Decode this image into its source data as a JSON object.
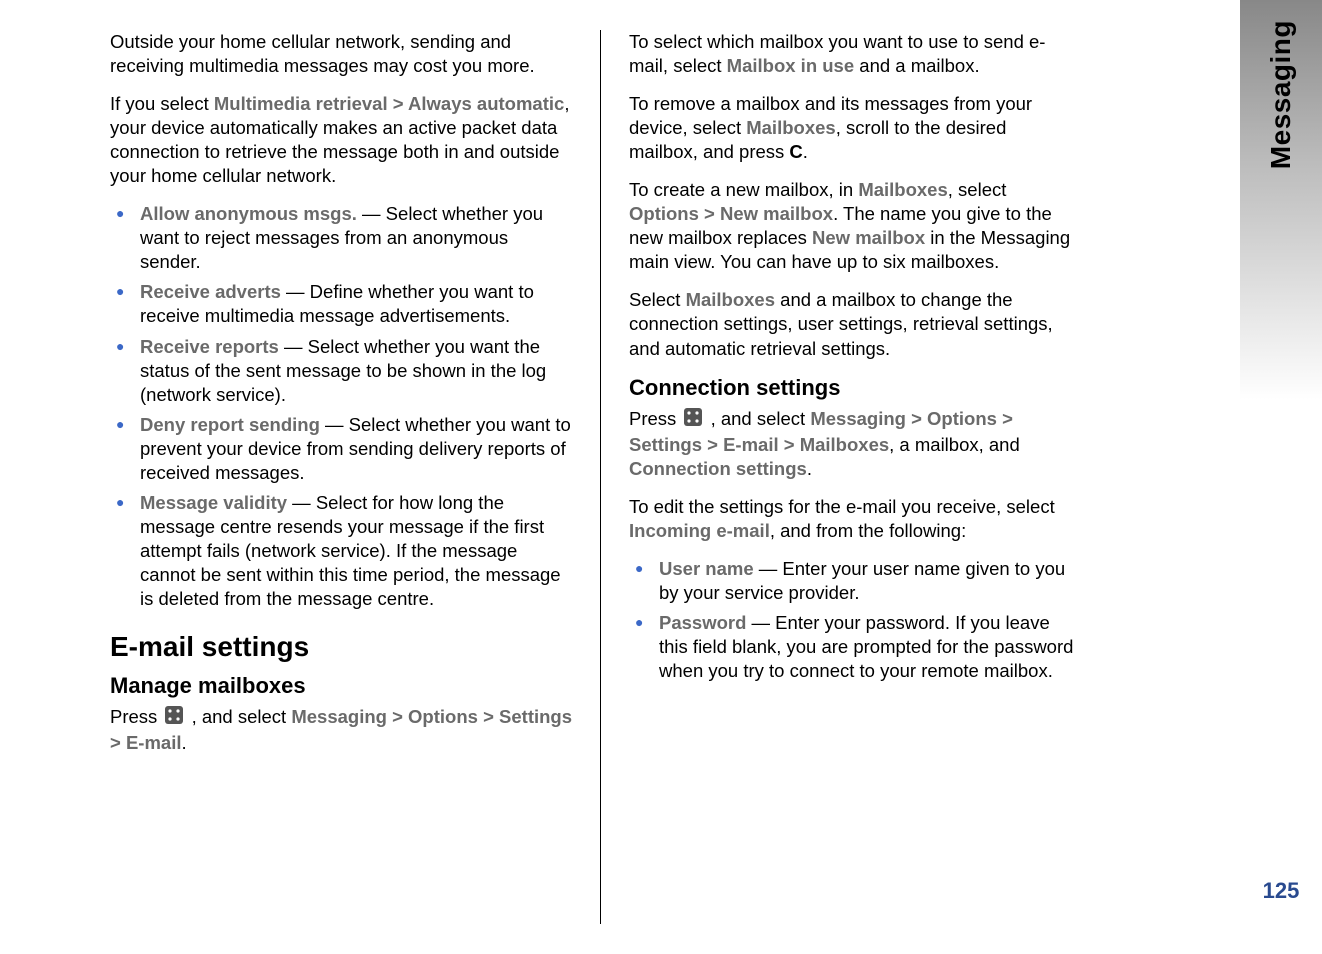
{
  "sidebar": {
    "section_title": "Messaging",
    "page_number": "125"
  },
  "left": {
    "p_cost": "Outside your home cellular network, sending and receiving multimedia messages may cost you more.",
    "retrieval": {
      "t1": "If you select ",
      "m1": "Multimedia retrieval",
      "gt1": " > ",
      "m2": "Always automatic",
      "t2": ", your device automatically makes an active packet data connection to retrieve the message both in and outside your home cellular network."
    },
    "bullets": [
      {
        "label": "Allow anonymous msgs.",
        "text": " — Select whether you want to reject messages from an anonymous sender."
      },
      {
        "label": "Receive adverts",
        "text": " — Define whether you want to receive multimedia message advertisements."
      },
      {
        "label": "Receive reports",
        "text": " — Select whether you want the status of the sent message to be shown in the log (network service)."
      },
      {
        "label": "Deny report sending",
        "text": " — Select whether you want to prevent your device from sending delivery reports of received messages."
      },
      {
        "label": "Message validity",
        "text": " — Select for how long the message centre resends your message if the first attempt fails (network service). If the message cannot be sent within this time period, the message is deleted from the message centre."
      }
    ],
    "h2_email": "E-mail settings",
    "h3_manage": "Manage mailboxes",
    "nav_manage": {
      "t1": "Press ",
      "t2": " , and select ",
      "m1": "Messaging",
      "gt1": " > ",
      "m2": "Options",
      "gt2": " > ",
      "m3": "Settings",
      "gt3": " > ",
      "m4": "E-mail",
      "t3": "."
    }
  },
  "right": {
    "p_select": {
      "t1": "To select which mailbox you want to use to send e-mail, select ",
      "m1": "Mailbox in use",
      "t2": " and a mailbox."
    },
    "p_remove": {
      "t1": "To remove a mailbox and its messages from your device, select ",
      "m1": "Mailboxes",
      "t2": ", scroll to the desired mailbox, and press ",
      "b1": "C",
      "t3": "."
    },
    "p_newmb": {
      "t1": "To create a new mailbox, in ",
      "m1": "Mailboxes",
      "t2": ", select ",
      "m2": "Options",
      "gt1": " > ",
      "m3": "New mailbox",
      "t3": ". The name you give to the new mailbox replaces ",
      "m4": "New mailbox",
      "t4": " in the Messaging main view. You can have up to six mailboxes."
    },
    "p_change": {
      "t1": "Select ",
      "m1": "Mailboxes",
      "t2": " and a mailbox to change the connection settings, user settings, retrieval settings, and automatic retrieval settings."
    },
    "h3_conn": "Connection settings",
    "nav_conn": {
      "t1": "Press ",
      "t2": " , and select ",
      "m1": "Messaging",
      "gt1": " > ",
      "m2": "Options",
      "gt2": " > ",
      "m3": "Settings",
      "gt3": " > ",
      "m4": "E-mail",
      "gt4": " > ",
      "m5": "Mailboxes",
      "t3": ", a mailbox, and ",
      "m6": "Connection settings",
      "t4": "."
    },
    "p_incoming": {
      "t1": "To edit the settings for the e-mail you receive, select ",
      "m1": "Incoming e-mail",
      "t2": ", and from the following:"
    },
    "bullets": [
      {
        "label": "User name",
        "text": " — Enter your user name given to you by your service provider."
      },
      {
        "label": "Password",
        "text": " — Enter your password. If you leave this field blank, you are prompted for the password when you try to connect to your remote mailbox."
      }
    ]
  }
}
